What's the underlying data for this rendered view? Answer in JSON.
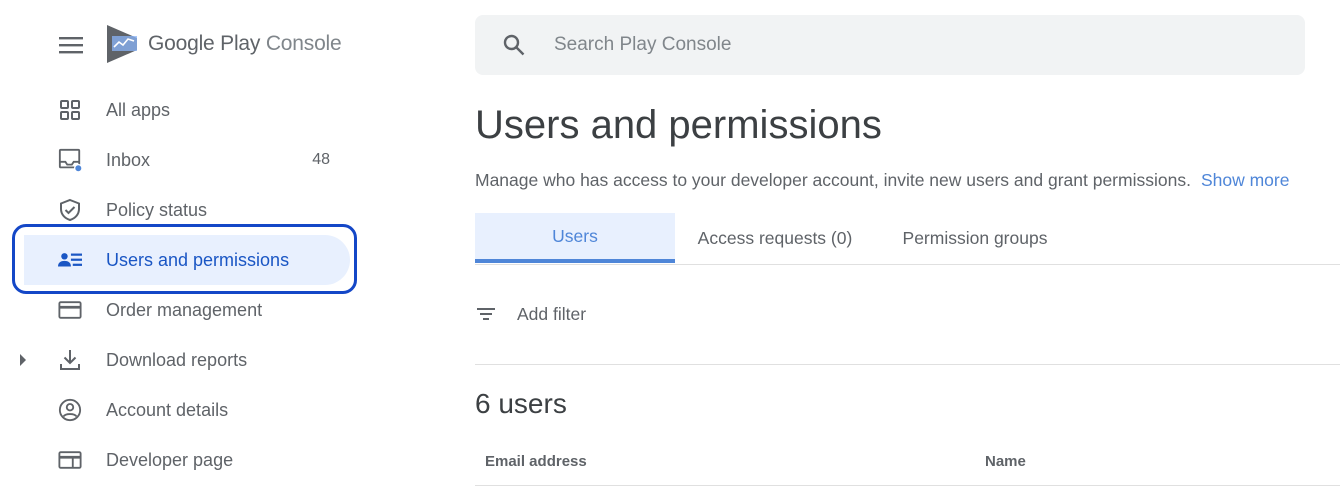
{
  "app": {
    "logo_primary": "Google Play",
    "logo_secondary": "Console"
  },
  "sidebar": {
    "items": [
      {
        "label": "All apps",
        "icon": "apps-grid-icon"
      },
      {
        "label": "Inbox",
        "icon": "inbox-icon",
        "count": "48"
      },
      {
        "label": "Policy status",
        "icon": "shield-check-icon"
      },
      {
        "label": "Users and permissions",
        "icon": "users-list-icon",
        "active": true
      },
      {
        "label": "Order management",
        "icon": "credit-card-icon"
      },
      {
        "label": "Download reports",
        "icon": "download-icon"
      },
      {
        "label": "Account details",
        "icon": "account-circle-icon"
      },
      {
        "label": "Developer page",
        "icon": "web-page-icon"
      }
    ]
  },
  "search": {
    "placeholder": "Search Play Console"
  },
  "main": {
    "title": "Users and permissions",
    "description": "Manage who has access to your developer account, invite new users and grant permissions.",
    "show_more": "Show more",
    "tabs": [
      {
        "label": "Users",
        "active": true
      },
      {
        "label": "Access requests (0)"
      },
      {
        "label": "Permission groups"
      }
    ],
    "filter_label": "Add filter",
    "users_count": "6 users",
    "columns": [
      "Email address",
      "Name"
    ]
  },
  "colors": {
    "accent": "#4f86d8",
    "active_bg": "#e8f0fe",
    "highlight": "#1447c7"
  }
}
